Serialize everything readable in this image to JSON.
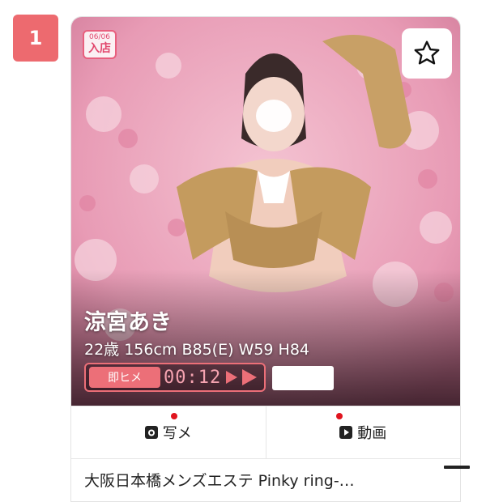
{
  "rank": "1",
  "badge": {
    "date": "06/06",
    "text": "入店"
  },
  "cast": {
    "name": "涼宮あき",
    "stats": "22歳 156cm B85(E) W59 H84"
  },
  "instant": {
    "label": "即ヒメ",
    "timer": "00:12"
  },
  "tabs": [
    {
      "label": "写メ",
      "icon": "camera-icon"
    },
    {
      "label": "動画",
      "icon": "play-icon"
    }
  ],
  "shop_name": "大阪日本橋メンズエステ Pinky ring-…",
  "colors": {
    "accent": "#ec6f78",
    "rank": "#ed6a6f",
    "dot": "#e0141e"
  }
}
